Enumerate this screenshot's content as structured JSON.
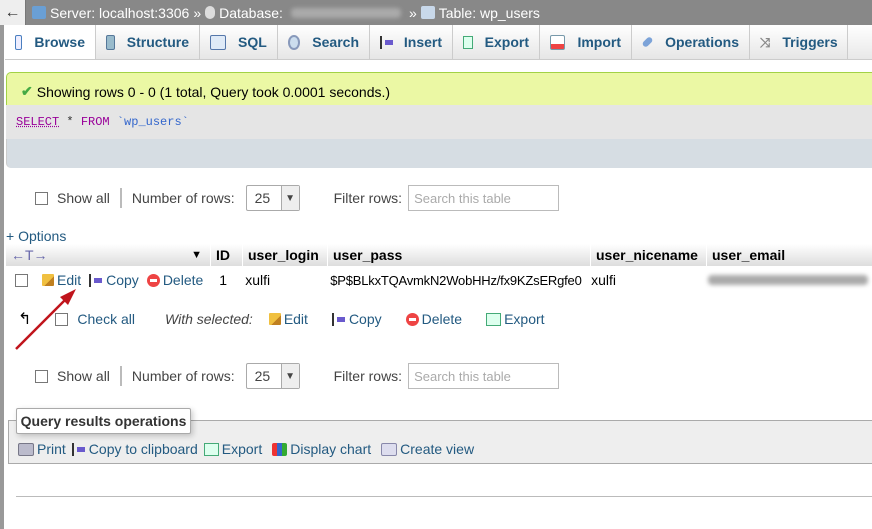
{
  "breadcrumb": {
    "back": "←",
    "server": "Server: localhost:3306",
    "sep": "»",
    "database_label": "Database:",
    "sep2": "»",
    "table": "Table: wp_users"
  },
  "tabs": [
    {
      "label": "Browse",
      "icon": "browse-icon",
      "active": true
    },
    {
      "label": "Structure",
      "icon": "structure-icon"
    },
    {
      "label": "SQL",
      "icon": "sql-icon"
    },
    {
      "label": "Search",
      "icon": "search-icon"
    },
    {
      "label": "Insert",
      "icon": "insert-icon"
    },
    {
      "label": "Export",
      "icon": "export-icon"
    },
    {
      "label": "Import",
      "icon": "import-icon"
    },
    {
      "label": "Operations",
      "icon": "wrench-icon"
    },
    {
      "label": "Triggers",
      "icon": "triggers-icon"
    }
  ],
  "notice": "Showing rows 0 - 0 (1 total, Query took 0.0001 seconds.)",
  "sql": {
    "select": "SELECT",
    "star": " * ",
    "from": "FROM",
    "table": " `wp_users`"
  },
  "nav": {
    "show_all": "Show all",
    "num_rows_label": "Number of rows:",
    "num_rows": "25",
    "filter_label": "Filter rows:",
    "filter_placeholder": "Search this table"
  },
  "options": "+ Options",
  "columns": [
    "ID",
    "user_login",
    "user_pass",
    "user_nicename",
    "user_email"
  ],
  "rows": [
    {
      "edit": "Edit",
      "copy": "Copy",
      "delete": "Delete",
      "ID": "1",
      "user_login": "xulfi",
      "user_pass": "$P$BLkxTQAvmkN2WobHHz/fx9KZsERgfe0",
      "user_nicename": "xulfi"
    }
  ],
  "bulk": {
    "check_all": "Check all",
    "with_selected": "With selected:",
    "edit": "Edit",
    "copy": "Copy",
    "delete": "Delete",
    "export": "Export"
  },
  "qro": {
    "title": "Query results operations",
    "items": [
      "Print",
      "Copy to clipboard",
      "Export",
      "Display chart",
      "Create view"
    ]
  },
  "colors": {
    "link": "#235a81",
    "notice_bg": "#ebf8a4",
    "annotation_arrow": "#c0141c"
  }
}
